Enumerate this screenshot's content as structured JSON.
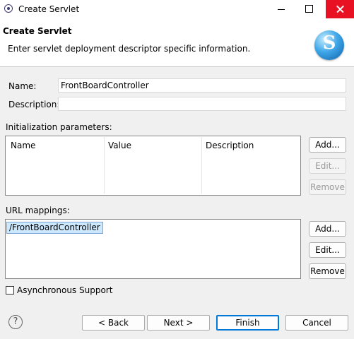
{
  "window": {
    "title": "Create Servlet"
  },
  "header": {
    "title": "Create Servlet",
    "description": "Enter servlet deployment descriptor specific information."
  },
  "form": {
    "name_label": "Name:",
    "name_value": "FrontBoardController",
    "description_label": "Description:",
    "description_value": ""
  },
  "init_params": {
    "label": "Initialization parameters:",
    "columns": [
      "Name",
      "Value",
      "Description"
    ],
    "buttons": {
      "add": "Add...",
      "edit": "Edit...",
      "remove": "Remove"
    }
  },
  "url_mappings": {
    "label": "URL mappings:",
    "items": [
      "/FrontBoardController"
    ],
    "buttons": {
      "add": "Add...",
      "edit": "Edit...",
      "remove": "Remove"
    }
  },
  "async": {
    "label": "Asynchronous Support",
    "checked": false
  },
  "footer": {
    "help_icon": "?",
    "back": "< Back",
    "next": "Next >",
    "finish": "Finish",
    "cancel": "Cancel"
  },
  "colors": {
    "close_button": "#e81123",
    "selection": "#cce8ff",
    "primary_border": "#0078d7"
  }
}
